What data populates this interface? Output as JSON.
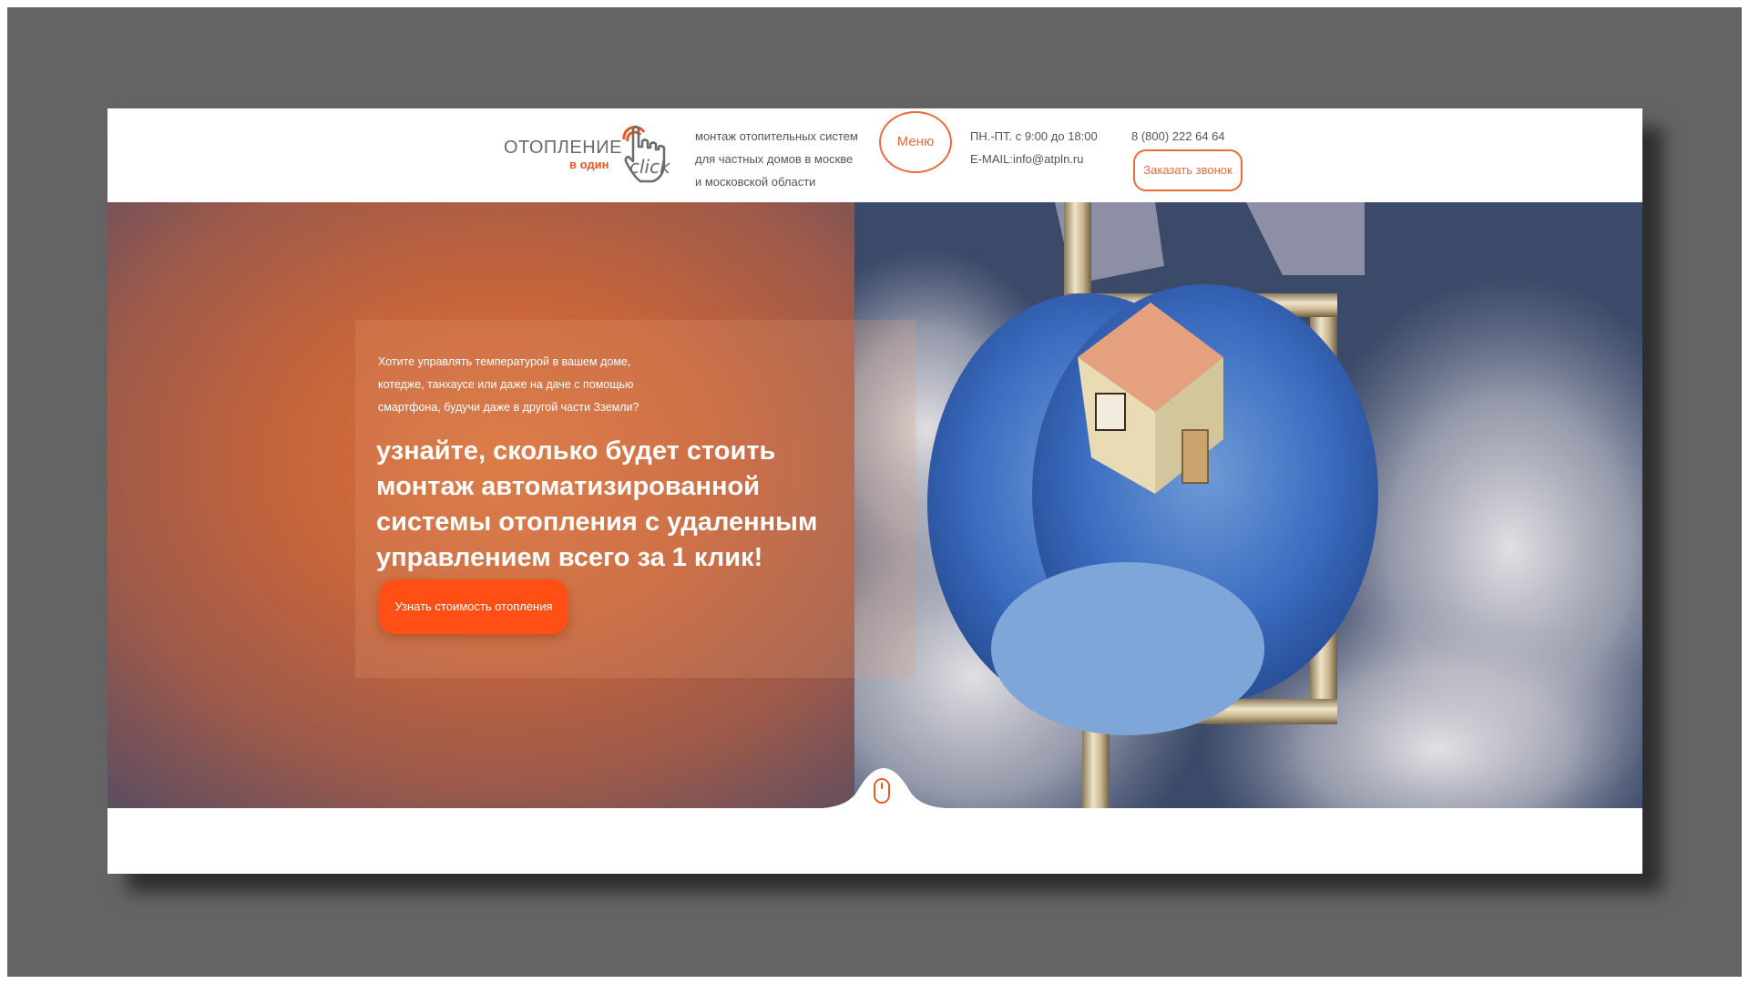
{
  "header": {
    "logo": {
      "line1": "ОТОПЛЕНИЕ",
      "line2": "в один",
      "click": "click"
    },
    "tagline": [
      "монтаж отопительных систем",
      "для частных домов в москве",
      "и московской области"
    ],
    "menu_label": "Меню",
    "hours": "ПН.-ПТ. с 9:00 до 18:00",
    "email": "E-MAIL:info@atpln.ru",
    "phone": "8 (800) 222 64 64",
    "callback_label": "Заказать звонок"
  },
  "hero": {
    "intro": [
      "Хотите управлять температурой в вашем доме,",
      "котедже, танхаусе или даже на даче с помощью",
      "смартфона, будучи даже в другой части Зземли?"
    ],
    "headline": [
      "узнайте, сколько будет стоить",
      "монтаж автоматизированной",
      "системы отопления с удаленным",
      "управлением всего за 1 клик!"
    ],
    "cta_label": "Узнать стоимость отопления"
  },
  "colors": {
    "accent": "#ee6a3a",
    "cta": "#ff4f14",
    "hero_bg": "#3b4a69",
    "frame": "#646464"
  },
  "icons": {
    "logo": "pointing-hand-click-icon",
    "scroll": "mouse-scroll-icon"
  }
}
